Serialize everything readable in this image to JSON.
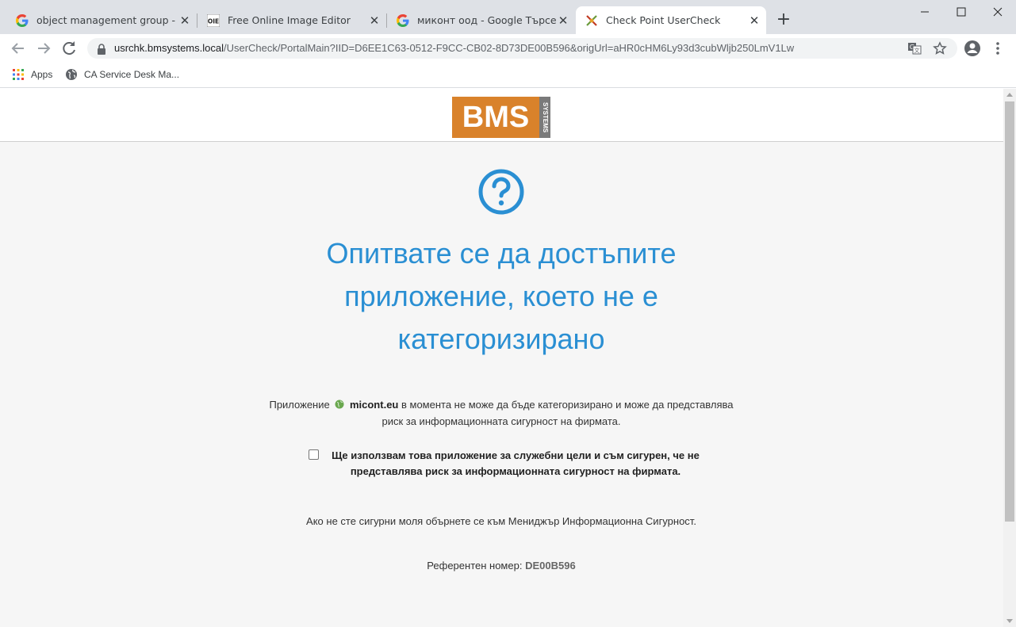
{
  "browser": {
    "tabs": [
      {
        "title": "object management group - Goo",
        "favicon": "google-icon"
      },
      {
        "title": "Free Online Image Editor",
        "favicon": "oie-icon"
      },
      {
        "title": "миконт оод - Google Търсене",
        "favicon": "google-icon"
      },
      {
        "title": "Check Point UserCheck",
        "favicon": "checkpoint-icon"
      }
    ],
    "active_tab": 3,
    "url_host": "usrchk.bmsystems.local",
    "url_rest": "/UserCheck/PortalMain?IID=D6EE1C63-0512-F9CC-CB02-8D73DE00B596&origUrl=aHR0cHM6Ly93d3cubWljb250LmV1Lw",
    "bookmarks": [
      {
        "label": "Apps",
        "icon": "apps-grid-icon"
      },
      {
        "label": "CA Service Desk Ma...",
        "icon": "globe-icon"
      }
    ]
  },
  "logo": {
    "main": "BMS",
    "side": "SYSTEMS"
  },
  "page": {
    "heading": "Опитвате се да достъпите приложение, което не е категоризирано",
    "desc_prefix": "Приложение",
    "app_name": "micont.eu",
    "desc_suffix": "в момента не може да бъде категоризирано и може да представлява риск за информационната сигурност на фирмата.",
    "checkbox_label": "Ще използвам това приложение за служебни цели и съм сигурен, че не представлява риск за информационната сигурност на фирмата.",
    "checkbox_checked": false,
    "contact": "Ако не сте сигурни моля обърнете се към Мениджър Информационна Сигурност.",
    "ref_label": "Референтен номер:",
    "ref_value": "DE00B596",
    "accent_color": "#2a8fd3"
  }
}
